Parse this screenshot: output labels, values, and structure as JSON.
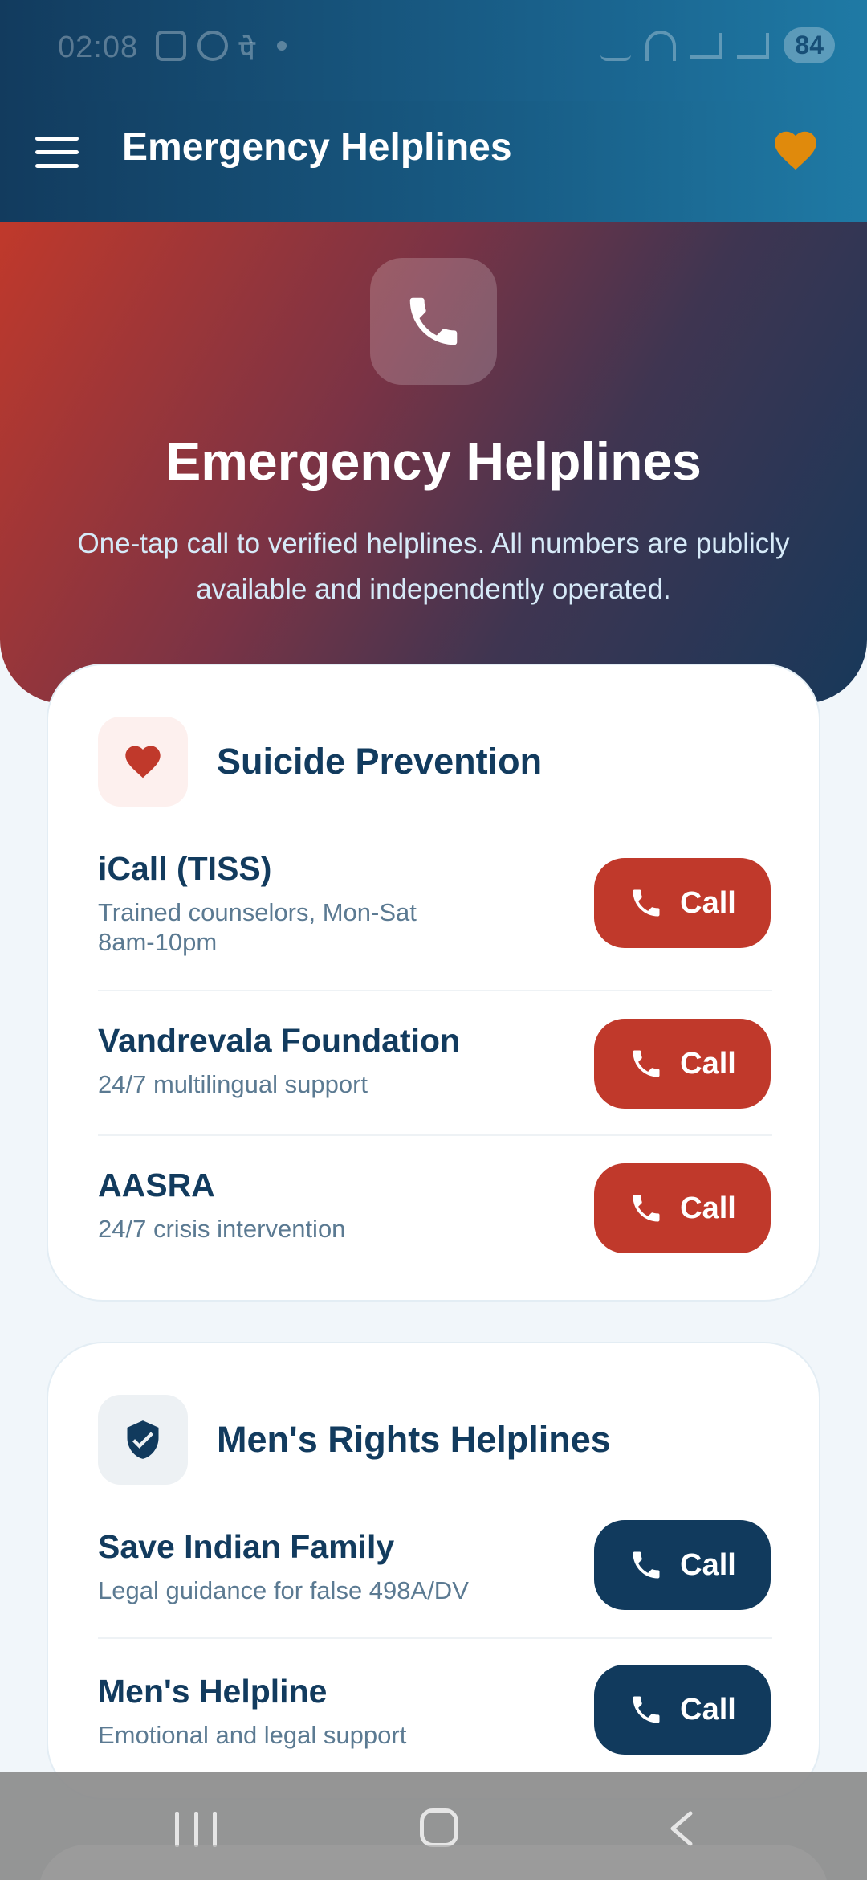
{
  "status_bar": {
    "time": "02:08",
    "battery": "84"
  },
  "app_bar": {
    "title": "Emergency Helplines",
    "menu_icon": "hamburger-icon",
    "favorite_icon": "heart-icon",
    "favorite_color": "#e08a0c"
  },
  "hero": {
    "icon": "phone-icon",
    "title": "Emergency Helplines",
    "subtitle": "One-tap call to verified helplines. All numbers are publicly available and independently operated."
  },
  "sections": [
    {
      "title": "Suicide Prevention",
      "icon": "heart-icon",
      "accent": "#c0392b",
      "items": [
        {
          "name": "iCall (TISS)",
          "desc": "Trained counselors, Mon-Sat 8am-10pm",
          "button": "Call"
        },
        {
          "name": "Vandrevala Foundation",
          "desc": "24/7 multilingual support",
          "button": "Call"
        },
        {
          "name": "AASRA",
          "desc": "24/7 crisis intervention",
          "button": "Call"
        }
      ]
    },
    {
      "title": "Men's Rights Helplines",
      "icon": "shield-check-icon",
      "accent": "#113a5d",
      "items": [
        {
          "name": "Save Indian Family",
          "desc": "Legal guidance for false 498A/DV",
          "button": "Call"
        },
        {
          "name": "Men's Helpline",
          "desc": "Emotional and legal support",
          "button": "Call"
        }
      ]
    }
  ]
}
